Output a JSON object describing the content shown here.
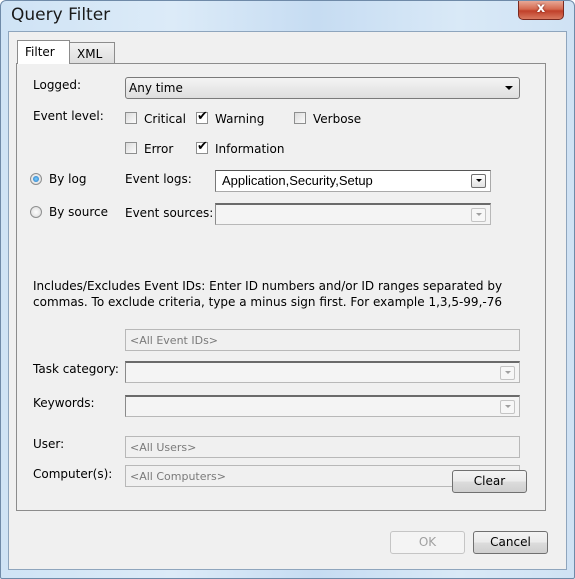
{
  "window": {
    "title": "Query Filter",
    "close_label": "x"
  },
  "tabs": [
    {
      "label": "Filter",
      "active": true
    },
    {
      "label": "XML",
      "active": false
    }
  ],
  "filter": {
    "logged": {
      "label": "Logged:",
      "value": "Any time"
    },
    "event_level": {
      "label": "Event level:",
      "options": [
        {
          "label": "Critical",
          "checked": false
        },
        {
          "label": "Warning",
          "checked": true
        },
        {
          "label": "Verbose",
          "checked": false
        },
        {
          "label": "Error",
          "checked": false
        },
        {
          "label": "Information",
          "checked": true
        }
      ]
    },
    "by_log": {
      "label": "By log",
      "selected": true
    },
    "by_source": {
      "label": "By source",
      "selected": false
    },
    "event_logs": {
      "label": "Event logs:",
      "value": "Application,Security,Setup"
    },
    "event_sources": {
      "label": "Event sources:",
      "value": ""
    },
    "event_ids_help": "Includes/Excludes Event IDs: Enter ID numbers and/or ID ranges separated by commas. To exclude criteria, type a minus sign first. For example 1,3,5-99,-76",
    "event_ids": {
      "placeholder": "<All Event IDs>"
    },
    "task_category": {
      "label": "Task category:",
      "value": ""
    },
    "keywords": {
      "label": "Keywords:",
      "value": ""
    },
    "user": {
      "label": "User:",
      "placeholder": "<All Users>"
    },
    "computers": {
      "label": "Computer(s):",
      "placeholder": "<All Computers>"
    },
    "check_mark": "✔",
    "clear_label": "Clear"
  },
  "footer": {
    "ok_label": "OK",
    "ok_enabled": false,
    "cancel_label": "Cancel"
  }
}
